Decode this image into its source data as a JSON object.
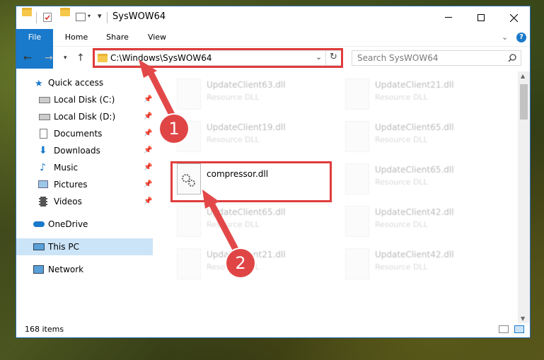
{
  "window": {
    "title": "SysWOW64",
    "minimize_icon": "minimize-icon",
    "maximize_icon": "maximize-icon",
    "close_icon": "close-icon"
  },
  "ribbon": {
    "tabs": [
      "File",
      "Home",
      "Share",
      "View"
    ]
  },
  "address": {
    "path": "C:\\Windows\\SysWOW64",
    "search_placeholder": "Search SysWOW64"
  },
  "nav": {
    "items": [
      {
        "label": "Quick access",
        "icon": "star-icon"
      },
      {
        "label": "Local Disk (C:)",
        "icon": "drive-icon",
        "pinned": true
      },
      {
        "label": "Local Disk (D:)",
        "icon": "drive-icon",
        "pinned": true
      },
      {
        "label": "Documents",
        "icon": "documents-icon",
        "pinned": true
      },
      {
        "label": "Downloads",
        "icon": "download-icon",
        "pinned": true
      },
      {
        "label": "Music",
        "icon": "music-icon",
        "pinned": true
      },
      {
        "label": "Pictures",
        "icon": "pictures-icon",
        "pinned": true
      },
      {
        "label": "Videos",
        "icon": "videos-icon",
        "pinned": true
      },
      {
        "label": "OneDrive",
        "icon": "cloud-icon"
      },
      {
        "label": "This PC",
        "icon": "computer-icon",
        "selected": true
      },
      {
        "label": "Network",
        "icon": "network-icon"
      }
    ]
  },
  "files": [
    {
      "name": "UpdateClient63.dll",
      "desc": "Resource DLL"
    },
    {
      "name": "UpdateClient21.dll",
      "desc": "Resource DLL"
    },
    {
      "name": "UpdateClient19.dll",
      "desc": "Resource DLL"
    },
    {
      "name": "UpdateClient65.dll",
      "desc": "Resource DLL"
    },
    {
      "name": "compressor.dll",
      "desc": ""
    },
    {
      "name": "UpdateClient65.dll",
      "desc": "Resource DLL"
    },
    {
      "name": "UpdateClient65.dll",
      "desc": "Resource DLL"
    },
    {
      "name": "UpdateClient42.dll",
      "desc": "Resource DLL"
    },
    {
      "name": "UpdateClient21.dll",
      "desc": "Resource DLL"
    },
    {
      "name": "UpdateClient42.dll",
      "desc": "Resource DLL"
    }
  ],
  "status": {
    "count": "168 items"
  },
  "annotations": {
    "step1": "1",
    "step2": "2",
    "color": "#e34848"
  }
}
